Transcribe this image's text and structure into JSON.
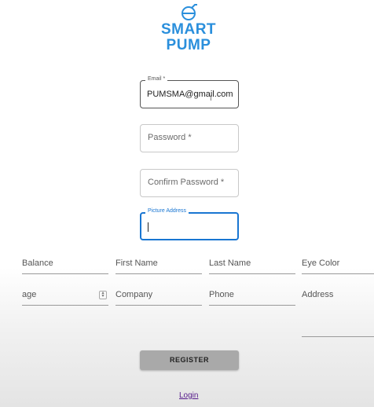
{
  "brand": {
    "line1": "SMART",
    "line2": "PUMP",
    "color": "#2a8fdc"
  },
  "form": {
    "email": {
      "label": "Email *",
      "value": "PUMSMA@gmail.com"
    },
    "password": {
      "placeholder": "Password *"
    },
    "confirm_password": {
      "placeholder": "Confirm Password *"
    },
    "picture_address": {
      "label": "Picture Address",
      "value": "",
      "state": "focused"
    },
    "balance": {
      "placeholder": "Balance"
    },
    "first_name": {
      "placeholder": "First Name"
    },
    "last_name": {
      "placeholder": "Last Name"
    },
    "eye_color": {
      "placeholder": "Eye Color"
    },
    "age": {
      "placeholder": "age"
    },
    "company": {
      "placeholder": "Company"
    },
    "phone": {
      "placeholder": "Phone"
    },
    "address": {
      "placeholder": "Address"
    }
  },
  "buttons": {
    "register": "REGISTER"
  },
  "links": {
    "login": "Login"
  },
  "colors": {
    "focus": "#1976d2",
    "link": "#551a8b",
    "button": "#a9a9a9"
  }
}
